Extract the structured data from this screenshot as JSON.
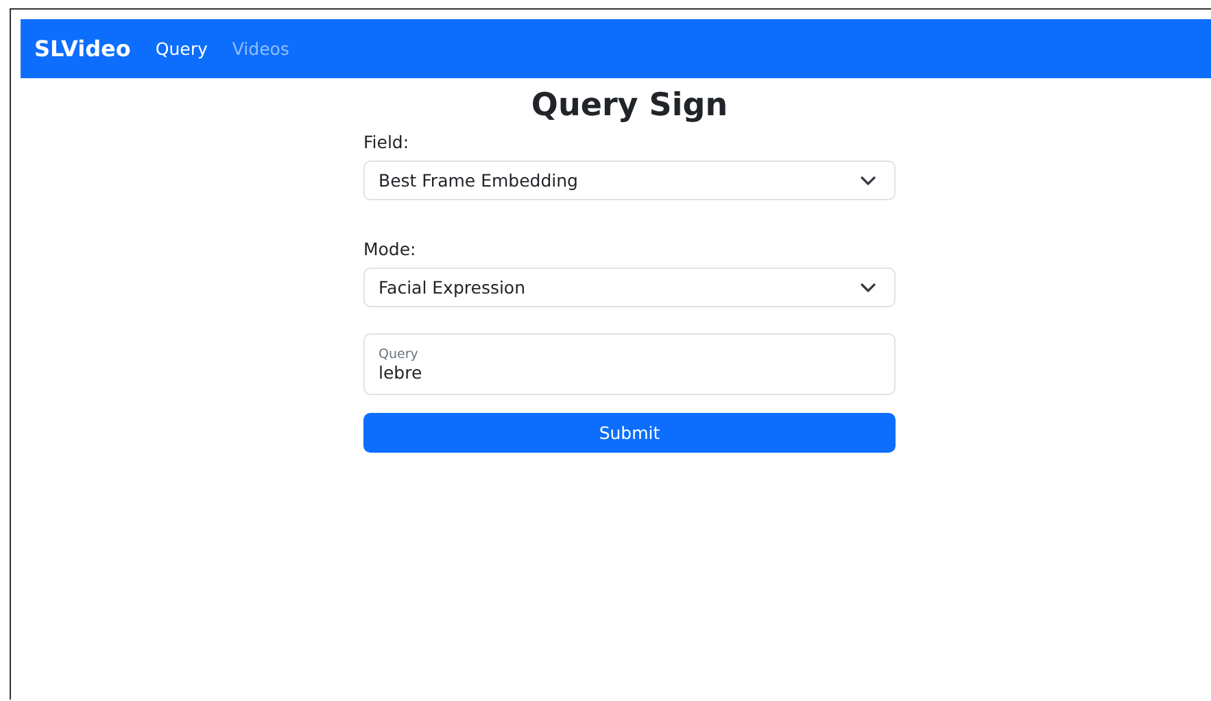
{
  "navbar": {
    "brand": "SLVideo",
    "links": [
      {
        "label": "Query",
        "selected": true
      },
      {
        "label": "Videos",
        "selected": false
      }
    ]
  },
  "title": "Query Sign",
  "fields": [
    {
      "label": "Field:",
      "value": "Best Frame Embedding"
    },
    {
      "label": "Mode:",
      "value": "Facial Expression"
    }
  ],
  "query": {
    "label": "Query",
    "value": "lebre"
  },
  "submit": "Submit"
}
